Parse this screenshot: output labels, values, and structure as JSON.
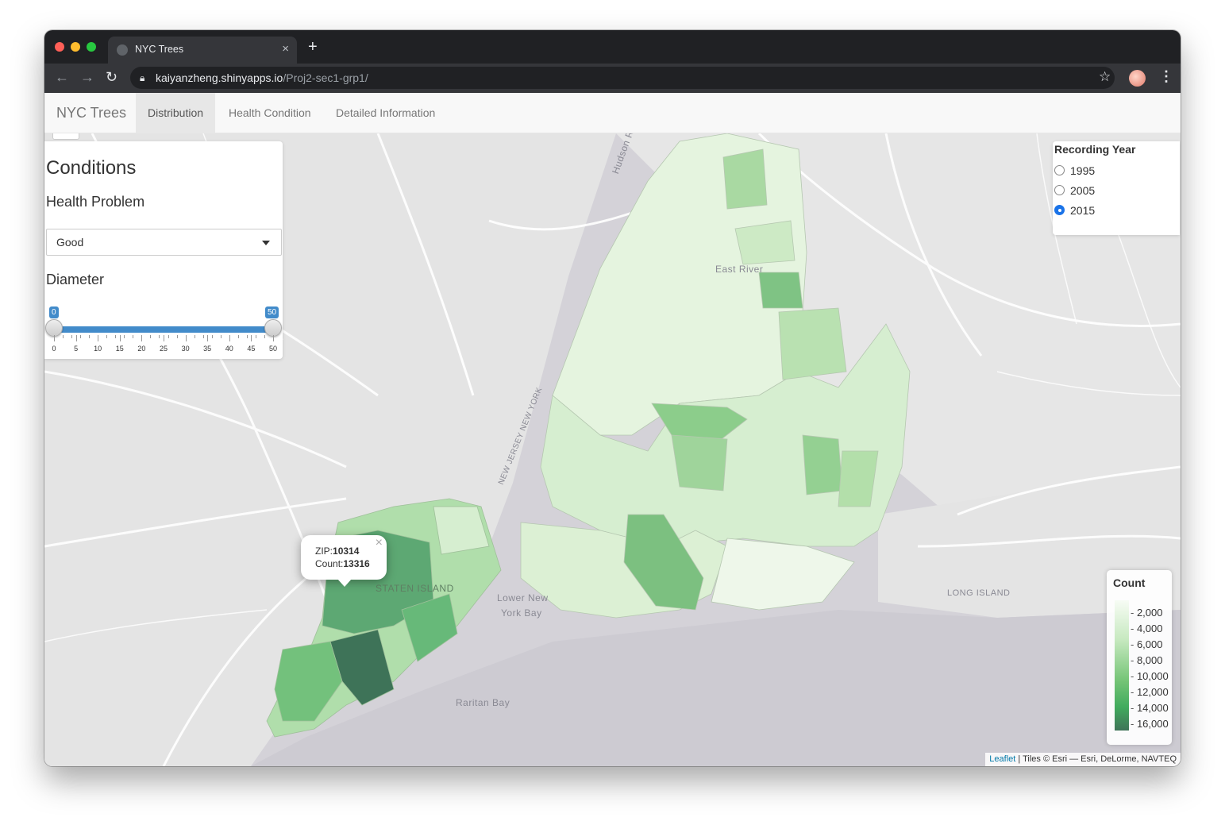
{
  "browser": {
    "tab_title": "NYC Trees",
    "tab_close": "×",
    "new_tab": "+",
    "url_host": "kaiyanzheng.shinyapps.io",
    "url_path": "/Proj2-sec1-grp1/"
  },
  "navbar": {
    "brand": "NYC Trees",
    "links": [
      {
        "label": "Distribution",
        "active": true
      },
      {
        "label": "Health Condition",
        "active": false
      },
      {
        "label": "Detailed Information",
        "active": false
      }
    ]
  },
  "conditions": {
    "title": "Conditions",
    "health_label": "Health Problem",
    "health_value": "Good",
    "diameter_label": "Diameter",
    "slider_min_value": "0",
    "slider_max_value": "50",
    "slider_ticks": [
      "0",
      "5",
      "10",
      "15",
      "20",
      "25",
      "30",
      "35",
      "40",
      "45",
      "50"
    ]
  },
  "year_panel": {
    "title": "Recording Year",
    "options": [
      {
        "label": "1995",
        "checked": false
      },
      {
        "label": "2005",
        "checked": false
      },
      {
        "label": "2015",
        "checked": true
      }
    ]
  },
  "popup": {
    "zip_label": "ZIP:",
    "zip_value": "10314",
    "count_label": "Count:",
    "count_value": "13316",
    "close": "×"
  },
  "legend": {
    "title": "Count",
    "labels": [
      "2,000",
      "4,000",
      "6,000",
      "8,000",
      "10,000",
      "12,000",
      "14,000",
      "16,000"
    ],
    "colors": {
      "low": "#f7fcf5",
      "high": "#3e7358"
    }
  },
  "map_labels": {
    "east_river": "East River",
    "hudson": "Hudson Riv",
    "nj_ny": "NEW JERSEY NEW YORK",
    "staten_island": "STATEN ISLAND",
    "lower_bay_1": "Lower New",
    "lower_bay_2": "York Bay",
    "raritan": "Raritan Bay",
    "long_island": "LONG ISLAND"
  },
  "attribution": {
    "leaflet": "Leaflet",
    "rest": " | Tiles © Esri — Esri, DeLorme, NAVTEQ"
  }
}
